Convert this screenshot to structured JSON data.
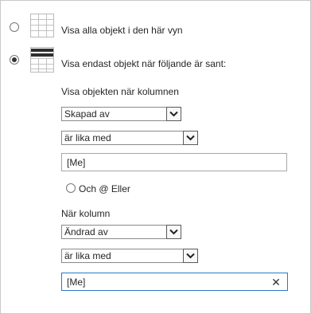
{
  "options": {
    "show_all_label": "Visa alla objekt i den här vyn",
    "show_filtered_label": "Visa endast objekt när följande är sant:"
  },
  "filter1": {
    "heading": "Visa objekten när kolumnen",
    "column": "Skapad av",
    "operator": "är lika med",
    "value": "[Me]"
  },
  "logic": {
    "label": "Och @ Eller"
  },
  "filter2": {
    "heading": "När kolumn",
    "column": "Ändrad av",
    "operator": "är lika med",
    "value": "[Me]"
  },
  "icons": {
    "show_all": "grid-list-icon",
    "show_filtered": "filtered-list-icon",
    "dropdown": "chevron-down-icon",
    "clear": "close-icon"
  }
}
